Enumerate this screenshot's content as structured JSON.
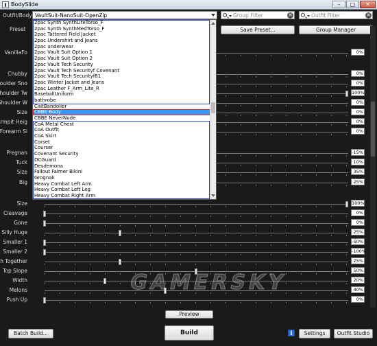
{
  "window": {
    "title": "BodySlide",
    "min": "–",
    "max": "□",
    "close": "✕"
  },
  "outfit": {
    "label": "Outfit/Body",
    "value": "VaultSuit-NanoSuit-OpenZip"
  },
  "group_filter": {
    "placeholder": "Group Filter"
  },
  "outfit_filter": {
    "placeholder": "Outfit Filter"
  },
  "preset": {
    "label": "Preset"
  },
  "buttons": {
    "save_preset": "Save Preset...",
    "group_manager": "Group Manager",
    "preview": "Preview",
    "batch_build": "Batch Build...",
    "build": "Build",
    "settings": "Settings",
    "outfit_studio": "Outfit Studio",
    "info": "i"
  },
  "dropdown_items": [
    "2pac Synth SynthLiteTorso_F",
    "2pac Synth SynthMedTorso_F",
    "2pac Tattered Field Jacket",
    "2pac Undershirt and Jeans",
    "2pac underwear",
    "2pac Vault Suit Option 1",
    "2pac Vault Suit Option 2",
    "2pac Vault Tech Security",
    "2pac Vault Tech Securityf Covenant",
    "2pac Vault Tech Securityf81",
    "2pac Winter Jacket and Jeans",
    "2pac Leather F_Arm_Lite_R",
    "BaseballUniform",
    "bathrobe",
    "CaitBandolier",
    "CBBE Body",
    "CBBE NeverNude",
    "CoA Metal Chest",
    "CoA Outfit",
    "CoA Skirt",
    "Corset",
    "Courser",
    "Covenant Security",
    "DCGuard",
    "Desdemona",
    "Fallout Falmer Bikini",
    "Grognak",
    "Heavy Combat Left Arm",
    "Heavy Combat Left Leg",
    "Heavy Combat Right Arm"
  ],
  "dropdown_selected": "CBBE Body",
  "sliders": [
    {
      "name": "VanillaFo",
      "value": "0%",
      "pos": 0
    },
    {
      "name": "Chubby",
      "value": "0%",
      "pos": 0
    },
    {
      "name": "Shoulder Sno",
      "value": "0%",
      "pos": 0
    },
    {
      "name": "Shoulder Tw",
      "value": "100%",
      "pos": 1
    },
    {
      "name": "Shoulder W",
      "value": "0%",
      "pos": 0
    },
    {
      "name": "Size",
      "value": "0%",
      "pos": 0
    },
    {
      "name": "Armpit Heig",
      "value": "0%",
      "pos": 0
    },
    {
      "name": "Forearm Si",
      "value": "0%",
      "pos": 0
    },
    {
      "name": "Pregnan",
      "value": "-15%",
      "pos": 0
    },
    {
      "name": "Tuck",
      "value": "10%",
      "pos": 0
    },
    {
      "name": "Size",
      "value": "35%",
      "pos": 0
    },
    {
      "name": "Big",
      "value": "25%",
      "pos": 0
    },
    {
      "name": "Size",
      "value": "100%",
      "pos": 1
    },
    {
      "name": "Cleavage",
      "value": "0%",
      "pos": 0
    },
    {
      "name": "Gone",
      "value": "0%",
      "pos": 0
    },
    {
      "name": "Silly Huge",
      "value": "25%",
      "pos": 0.25
    },
    {
      "name": "Smaller 1",
      "value": "-50%",
      "pos": 0
    },
    {
      "name": "Smaller 2",
      "value": "-100%",
      "pos": 0
    },
    {
      "name": "Push Together",
      "value": "25%",
      "pos": 0.25
    },
    {
      "name": "Top Slope",
      "value": "50%",
      "pos": 0.5
    },
    {
      "name": "Width",
      "value": "20%",
      "pos": 0.2
    },
    {
      "name": "Melons",
      "value": "40%",
      "pos": 0.4
    },
    {
      "name": "Push Up",
      "value": "0%",
      "pos": 0
    }
  ],
  "watermark": "GAMERSKY"
}
